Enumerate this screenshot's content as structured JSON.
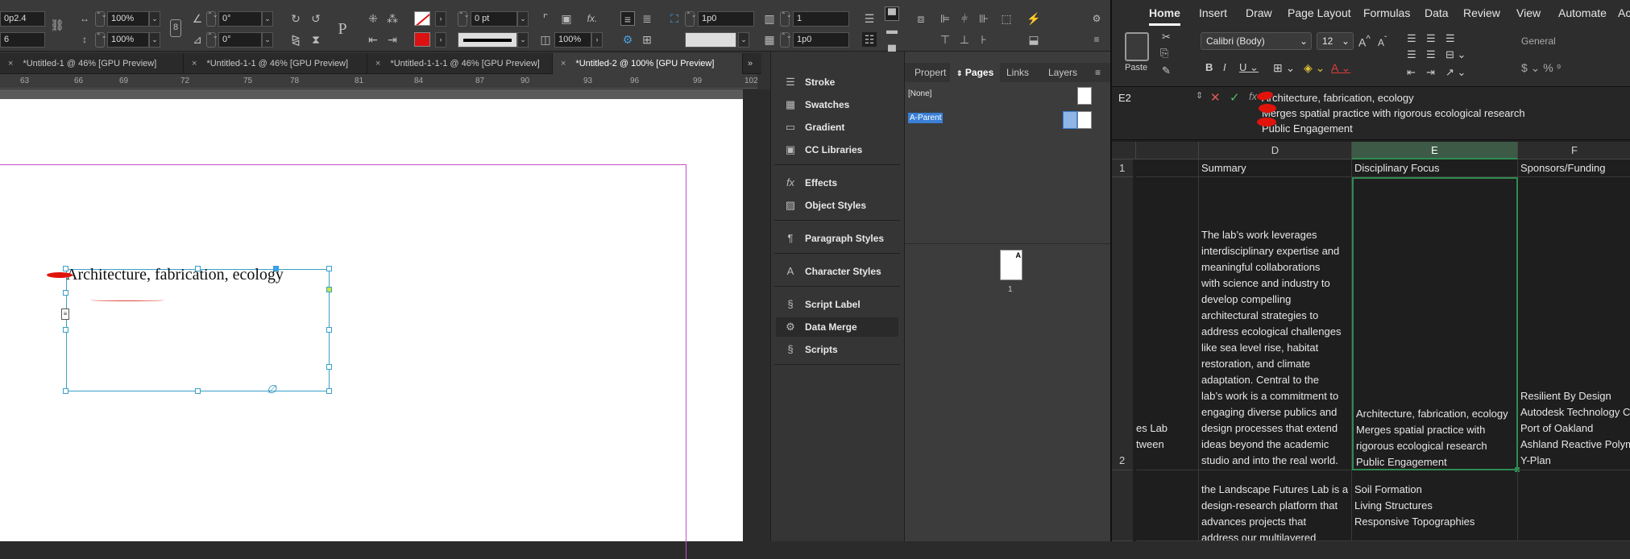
{
  "indesign": {
    "control": {
      "x_field": "0p2.4",
      "y_field": "6",
      "scale_x": "100%",
      "scale_y": "100%",
      "rotate": "0°",
      "shear": "0°",
      "stroke_weight": "0 pt",
      "opacity": "100%",
      "gap_1": "1p0",
      "gap_2": "1p0",
      "columns": "1",
      "col_gap": "1p0",
      "fx_label": "fx.",
      "type_tool": "P"
    },
    "tabs": [
      "*Untitled-1 @ 46% [GPU Preview]",
      "*Untitled-1-1 @ 46% [GPU Preview]",
      "*Untitled-1-1-1 @ 46% [GPU Preview]",
      "*Untitled-2 @ 100% [GPU Preview]"
    ],
    "ruler_numbers": [
      "63",
      "66",
      "69",
      "72",
      "75",
      "78",
      "81",
      "84",
      "87",
      "90",
      "93",
      "96",
      "99",
      "102"
    ],
    "frame_text": "Architecture, fabrication, ecology",
    "panels": {
      "items": [
        "Stroke",
        "Swatches",
        "Gradient",
        "CC Libraries",
        "Effects",
        "Object Styles",
        "Paragraph Styles",
        "Character Styles",
        "Script Label",
        "Data Merge",
        "Scripts"
      ],
      "selected": "Data Merge"
    },
    "pages_panel": {
      "tabs": [
        "Propert",
        "Pages",
        "Links",
        "Layers"
      ],
      "active_tab": "Pages",
      "none_label": "[None]",
      "parent_label": "A-Parent",
      "page_number": "1",
      "page_letter": "A"
    }
  },
  "excel": {
    "tabs": [
      "Home",
      "Insert",
      "Draw",
      "Page Layout",
      "Formulas",
      "Data",
      "Review",
      "View",
      "Automate",
      "Ac"
    ],
    "active_tab": "Home",
    "ribbon": {
      "paste_label": "Paste",
      "font_name": "Calibri (Body)",
      "font_size": "12",
      "number_format": "General"
    },
    "name_box": "E2",
    "formula_lines": [
      "Architecture, fabrication, ecology",
      "Merges spatial practice with rigorous ecological research",
      "Public Engagement"
    ],
    "columns": [
      "D",
      "E",
      "F"
    ],
    "rows": [
      "1",
      "2"
    ],
    "header_cells": [
      "Summary",
      "Disciplinary Focus",
      "Sponsors/Funding"
    ],
    "row2": {
      "c_lines": [
        "es Lab",
        "",
        "tween"
      ],
      "d_lines": [
        "The lab’s work leverages",
        "interdisciplinary expertise and",
        "meaningful collaborations",
        "with science and industry to",
        "develop compelling",
        "architectural strategies to",
        "address ecological challenges",
        "like sea level rise, habitat",
        "restoration, and climate",
        "adaptation. Central to the",
        "lab’s work is a commitment to",
        "engaging diverse publics and",
        "design processes that extend",
        "ideas beyond the academic",
        "studio and into the real world."
      ],
      "e_lines": [
        "Architecture, fabrication, ecology",
        "Merges spatial practice with",
        "rigorous ecological research",
        "Public Engagement"
      ],
      "f_lines": [
        "Resilient By Design",
        "Autodesk Technology Cente",
        "Port of Oakland",
        "Ashland Reactive Polymers",
        "Y-Plan"
      ]
    },
    "row3": {
      "d_lines": [
        "the Landscape Futures Lab is a",
        "design-research platform that",
        "advances projects that",
        "address our multilayered"
      ],
      "e_lines": [
        "",
        "Soil Formation",
        "Living Structures",
        "Responsive Topographies"
      ]
    }
  }
}
